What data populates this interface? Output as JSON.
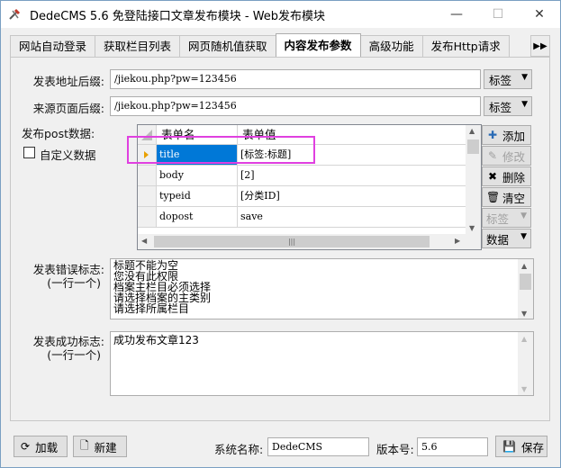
{
  "window": {
    "title": "DedeCMS 5.6 免登陆接口文章发布模块 - Web发布模块",
    "minimize_glyph": "—",
    "maximize_glyph": "☐",
    "close_glyph": "✕"
  },
  "tabs": [
    {
      "label": "网站自动登录",
      "active": false
    },
    {
      "label": "获取栏目列表",
      "active": false
    },
    {
      "label": "网页随机值获取",
      "active": false
    },
    {
      "label": "内容发布参数",
      "active": true
    },
    {
      "label": "高级功能",
      "active": false
    },
    {
      "label": "发布Http请求",
      "active": false
    }
  ],
  "tab_scroll_glyph": "▶▶",
  "form": {
    "post_url_label": "发表地址后缀:",
    "post_url_value": "/jiekou.php?pw=123456",
    "post_url_tag": "标签",
    "referer_label": "来源页面后缀:",
    "referer_value": "/jiekou.php?pw=123456",
    "referer_tag": "标签",
    "post_data_label": "发布post数据:",
    "custom_data_label": "自定义数据"
  },
  "grid": {
    "columns": [
      "表单名",
      "表单值"
    ],
    "rows": [
      {
        "name": "title",
        "value": "[标签:标题]",
        "selected": true
      },
      {
        "name": "body",
        "value": "[2]",
        "selected": false
      },
      {
        "name": "typeid",
        "value": "[分类ID]",
        "selected": false
      },
      {
        "name": "dopost",
        "value": "save",
        "selected": false
      }
    ],
    "hscroll_thumb": "|||"
  },
  "side_buttons": {
    "add": "添加",
    "edit": "修改",
    "delete": "删除",
    "clear": "清空",
    "tag": "标签",
    "data": "数据"
  },
  "error": {
    "label": "发表错误标志:",
    "sub_label": "(一行一个)",
    "lines": [
      "标题不能为空",
      "您没有此权限",
      "档案主栏目必须选择",
      "请选择档案的主类别",
      "请选择所属栏目"
    ]
  },
  "success": {
    "label": "发表成功标志:",
    "sub_label": "(一行一个)",
    "lines": [
      "成功发布文章123"
    ]
  },
  "bottom": {
    "load": "加载",
    "new": "新建",
    "system_name_label": "系统名称:",
    "system_name_value": "DedeCMS",
    "version_label": "版本号:",
    "version_value": "5.6",
    "save": "保存"
  },
  "colors": {
    "highlight": "#e040e0",
    "selected_cell": "#0078d7",
    "accent": "#3c7fb1"
  }
}
